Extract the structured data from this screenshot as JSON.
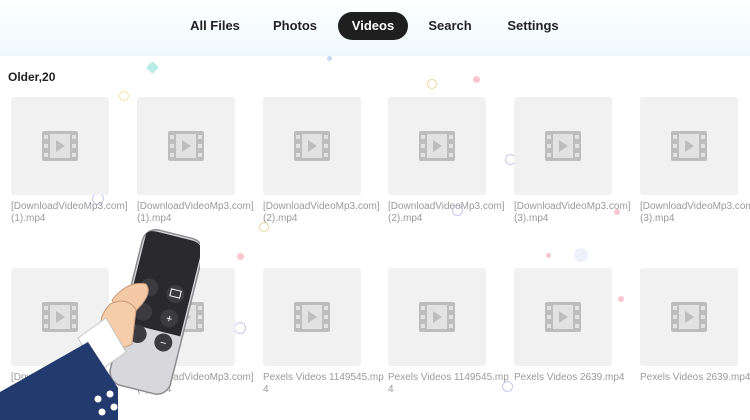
{
  "nav": {
    "tabs": [
      {
        "label": "All Files",
        "active": false
      },
      {
        "label": "Photos",
        "active": false
      },
      {
        "label": "Videos",
        "active": true
      },
      {
        "label": "Search",
        "active": false
      },
      {
        "label": "Settings",
        "active": false
      }
    ]
  },
  "section": {
    "title": "Older,20"
  },
  "videos": [
    {
      "name": "[DownloadVideoMp3.com] (1).mp4"
    },
    {
      "name": "[DownloadVideoMp3.com] (1).mp4"
    },
    {
      "name": "[DownloadVideoMp3.com] (2).mp4"
    },
    {
      "name": "[DownloadVideoMp3.com] (2).mp4"
    },
    {
      "name": "[DownloadVideoMp3.com] (3).mp4"
    },
    {
      "name": "[DownloadVideoMp3.com] (3).mp4"
    },
    {
      "name": "[DownloadVideoMp3.com] (4).mp4"
    },
    {
      "name": "[DownloadVideoMp3.com] (4).mp4"
    },
    {
      "name": "Pexels Videos 1149545.mp4"
    },
    {
      "name": "Pexels Videos 1149545.mp4"
    },
    {
      "name": "Pexels Videos 2639.mp4"
    },
    {
      "name": "Pexels Videos 2639.mp4"
    }
  ],
  "icons": {
    "thumbnail": "film-icon",
    "remote": "tv-remote-icon"
  },
  "colors": {
    "active_tab_bg": "#1f1f1f",
    "tile_bg": "#f1f1f1",
    "caption": "#9a9a9a"
  }
}
